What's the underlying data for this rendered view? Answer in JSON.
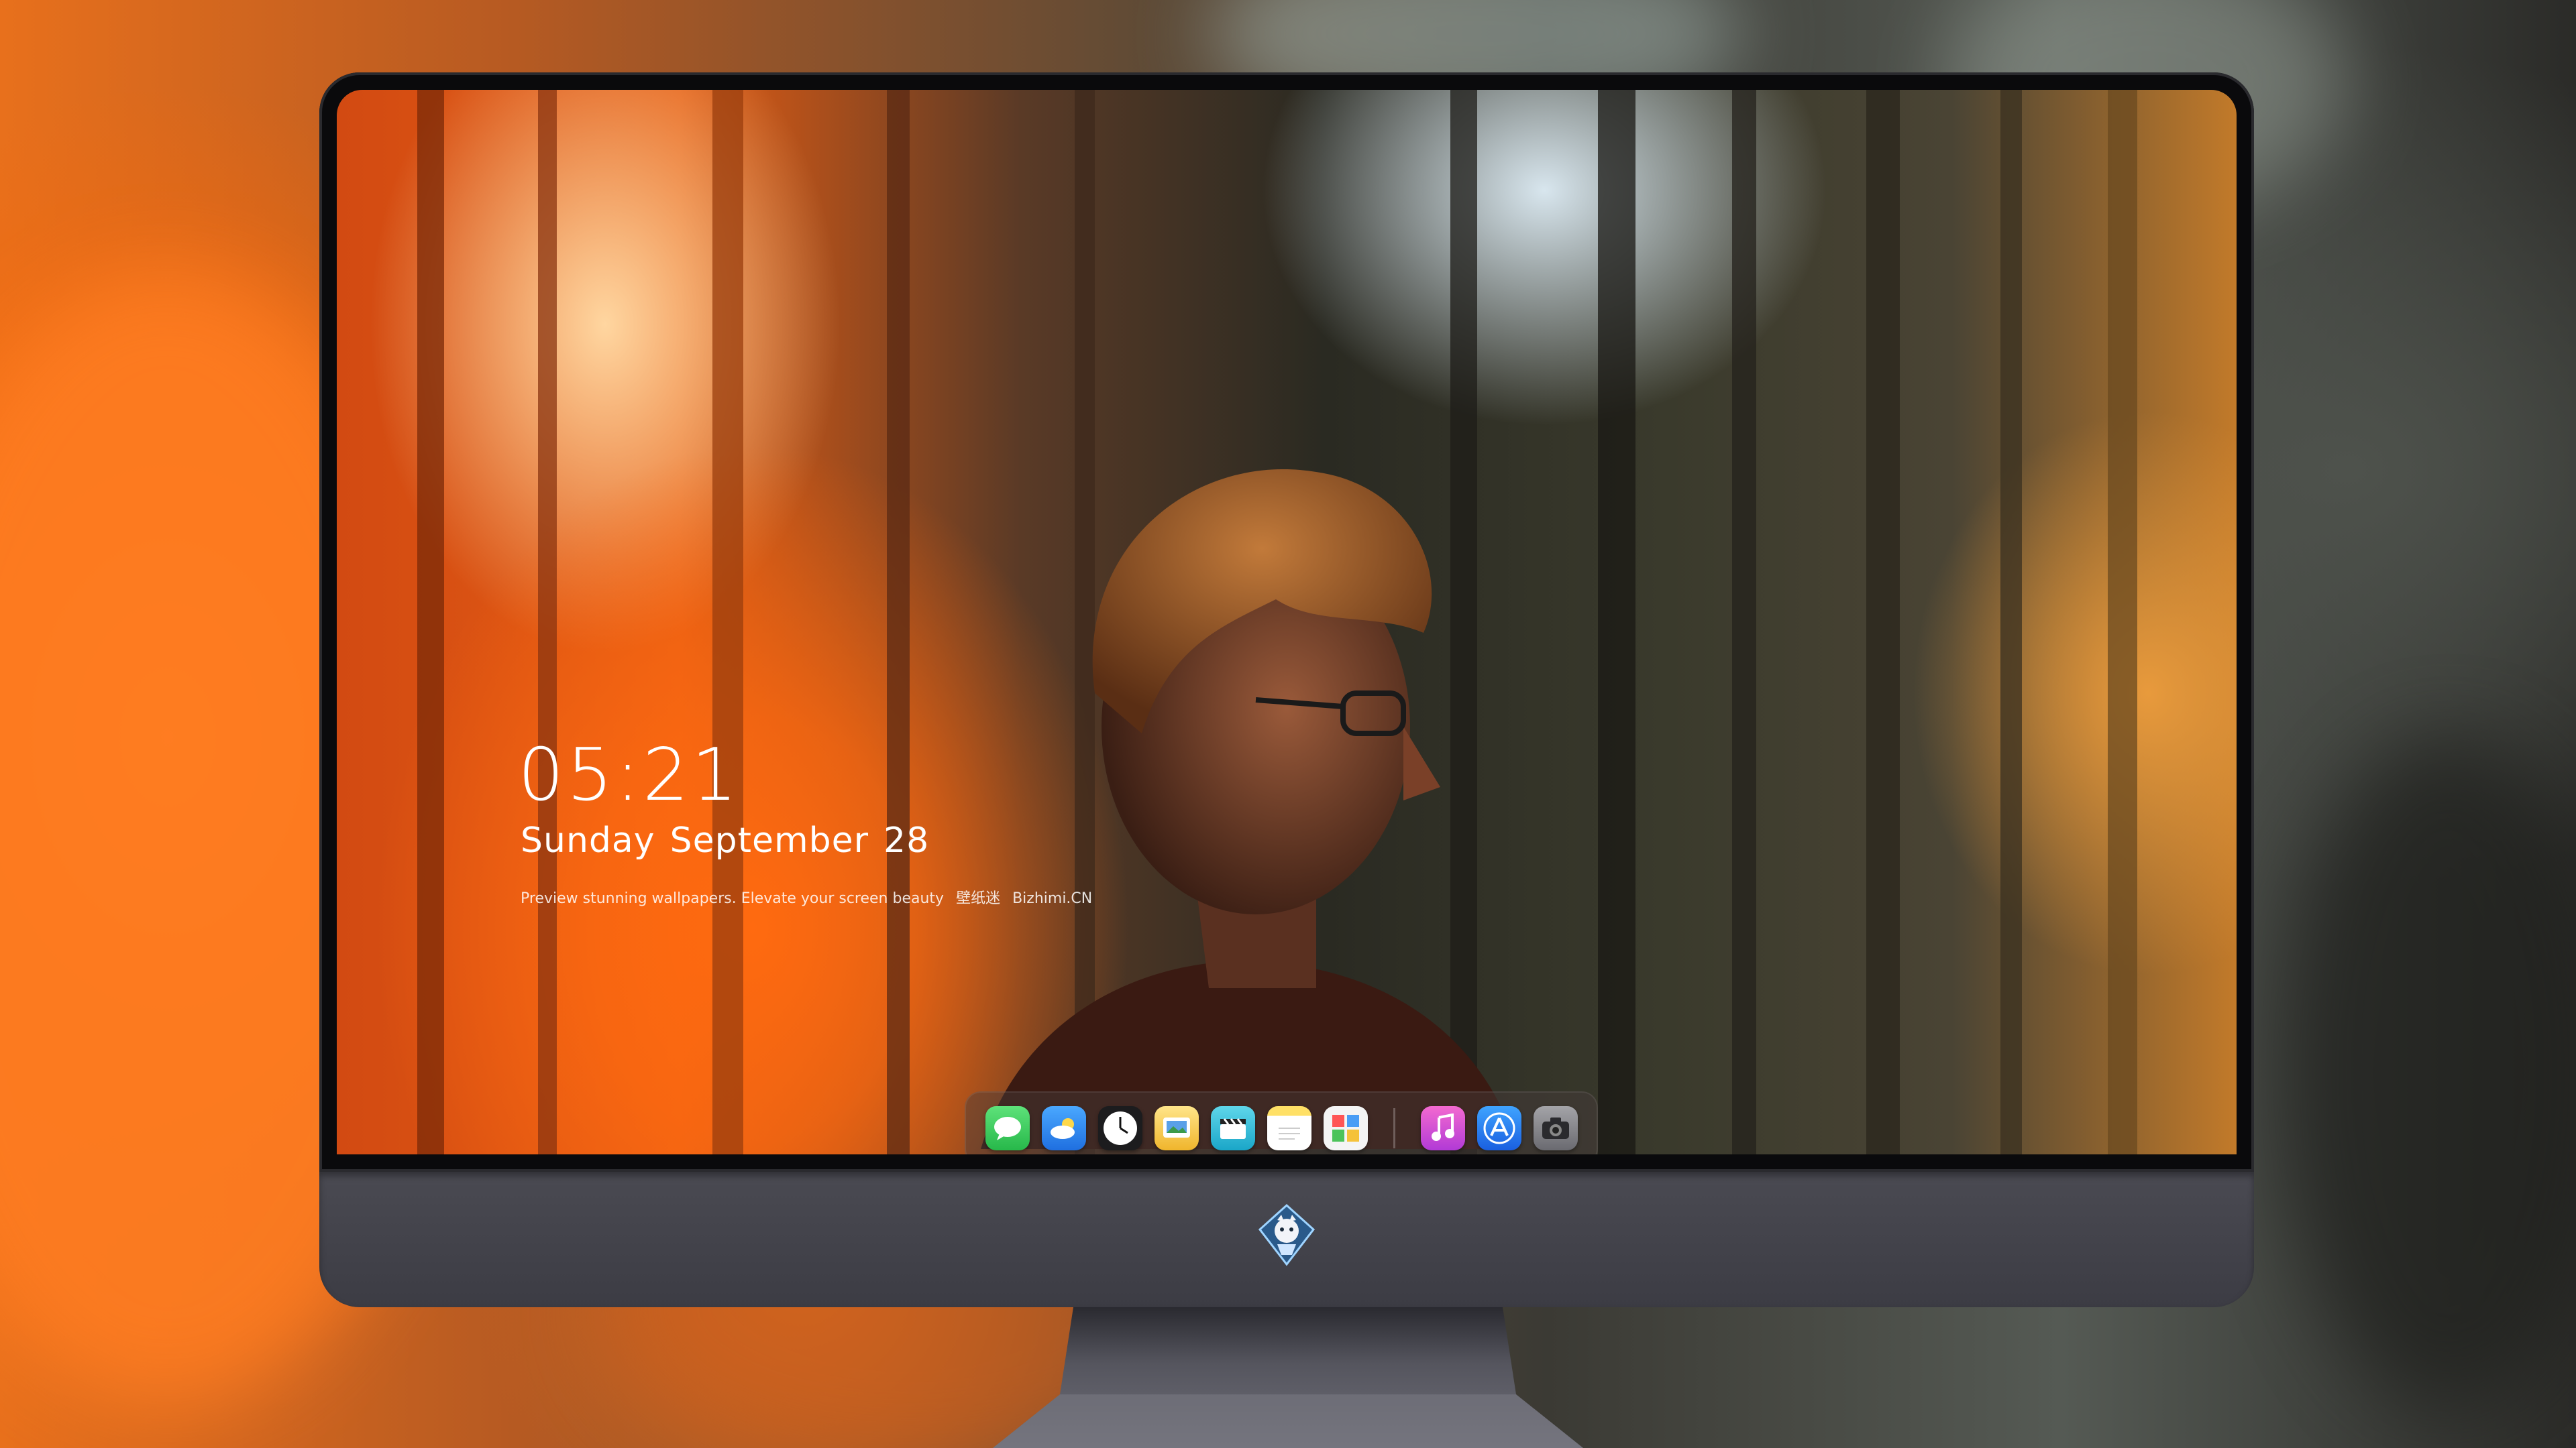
{
  "lock_screen": {
    "time": "05:21",
    "date": {
      "weekday": "Sunday",
      "month": "September",
      "day": "28"
    },
    "tagline": {
      "text": "Preview stunning wallpapers. Elevate your screen beauty",
      "brand_cn": "壁纸迷",
      "brand_url": "Bizhimi.CN"
    }
  },
  "dock": {
    "items": [
      {
        "name": "messages",
        "icon": "message-bubble-icon",
        "color": "#35c759"
      },
      {
        "name": "weather",
        "icon": "cloud-sun-icon",
        "color": "#2f8ef0"
      },
      {
        "name": "clock",
        "icon": "clock-icon",
        "color": "#ffffff"
      },
      {
        "name": "preview",
        "icon": "photo-viewer-icon",
        "color": "#f1c232"
      },
      {
        "name": "video",
        "icon": "clapperboard-icon",
        "color": "#2fc0d8"
      },
      {
        "name": "notes",
        "icon": "notes-icon",
        "color": "#ffe066"
      },
      {
        "name": "photo-booth",
        "icon": "photo-grid-icon",
        "color": "#f2f2f2"
      },
      {
        "name": "music",
        "icon": "music-note-icon",
        "color": "#e14bb4"
      },
      {
        "name": "app-store",
        "icon": "app-store-icon",
        "color": "#2d7cf6"
      },
      {
        "name": "camera",
        "icon": "camera-icon",
        "color": "#8a8a8e"
      }
    ]
  },
  "colors": {
    "accent_orange": "#ff6a10",
    "monitor_chin": "#3c3c44",
    "bezel": "#0a0a0c"
  }
}
